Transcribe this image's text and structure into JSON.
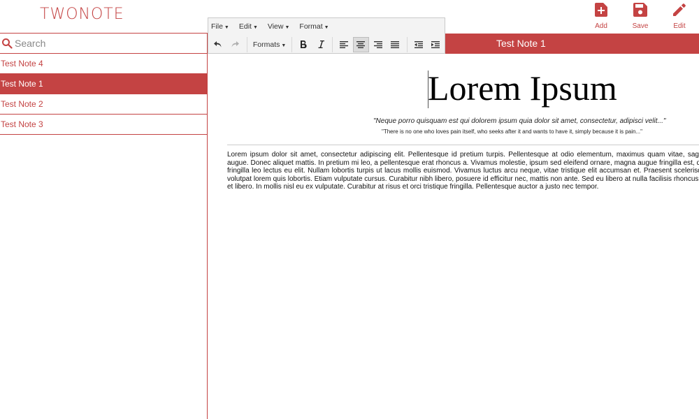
{
  "app": {
    "logo": "TWONOTE"
  },
  "actions": [
    {
      "label": "Add",
      "icon": "add-note-icon"
    },
    {
      "label": "Save",
      "icon": "save-icon"
    },
    {
      "label": "Edit",
      "icon": "pencil-icon"
    }
  ],
  "sidebar": {
    "search_placeholder": "Search",
    "notes": [
      {
        "title": "Test Note 4",
        "active": false
      },
      {
        "title": "Test Note 1",
        "active": true
      },
      {
        "title": "Test Note 2",
        "active": false
      },
      {
        "title": "Test Note 3",
        "active": false
      }
    ]
  },
  "editor": {
    "note_title": "Test Note 1",
    "menus": [
      "File",
      "Edit",
      "View",
      "Format"
    ],
    "formats_label": "Formats",
    "toolbar_icons": [
      "undo-icon",
      "redo-icon",
      "bold-icon",
      "italic-icon",
      "align-left-icon",
      "align-center-icon",
      "align-right-icon",
      "align-justify-icon",
      "outdent-icon",
      "indent-icon"
    ],
    "active_alignment": "center",
    "document": {
      "heading": "Lorem Ipsum",
      "quote": "\"Neque porro quisquam est qui dolorem ipsum quia dolor sit amet, consectetur, adipisci velit...\"",
      "quote_translation": "\"There is no one who loves pain itself, who seeks after it and wants to have it, simply because it is pain...\"",
      "paragraph": "Lorem ipsum dolor sit amet, consectetur adipiscing elit. Pellentesque id pretium turpis. Pellentesque at odio elementum, maximus quam vitae, sagittis augue. Donec aliquet mattis. In pretium mi leo, a pellentesque erat rhoncus a. Vivamus molestie, ipsum sed eleifend ornare, magna augue fringilla est, quis fringilla leo lectus eu elit. Nullam lobortis turpis ut lacus mollis euismod. Vivamus luctus arcu neque, vitae tristique elit accumsan et. Praesent scelerisque volutpat lorem quis lobortis. Etiam vulputate cursus. Curabitur nibh libero, posuere id efficitur nec, mattis non ante. Sed eu libero at nulla facilisis rhoncus vel et libero. In mollis nisl eu ex vulputate. Curabitur at risus et orci tristique fringilla. Pellentesque auctor a justo nec tempor."
    }
  },
  "colors": {
    "accent": "#c44343",
    "toolbar_bg": "#f3f3f3"
  }
}
